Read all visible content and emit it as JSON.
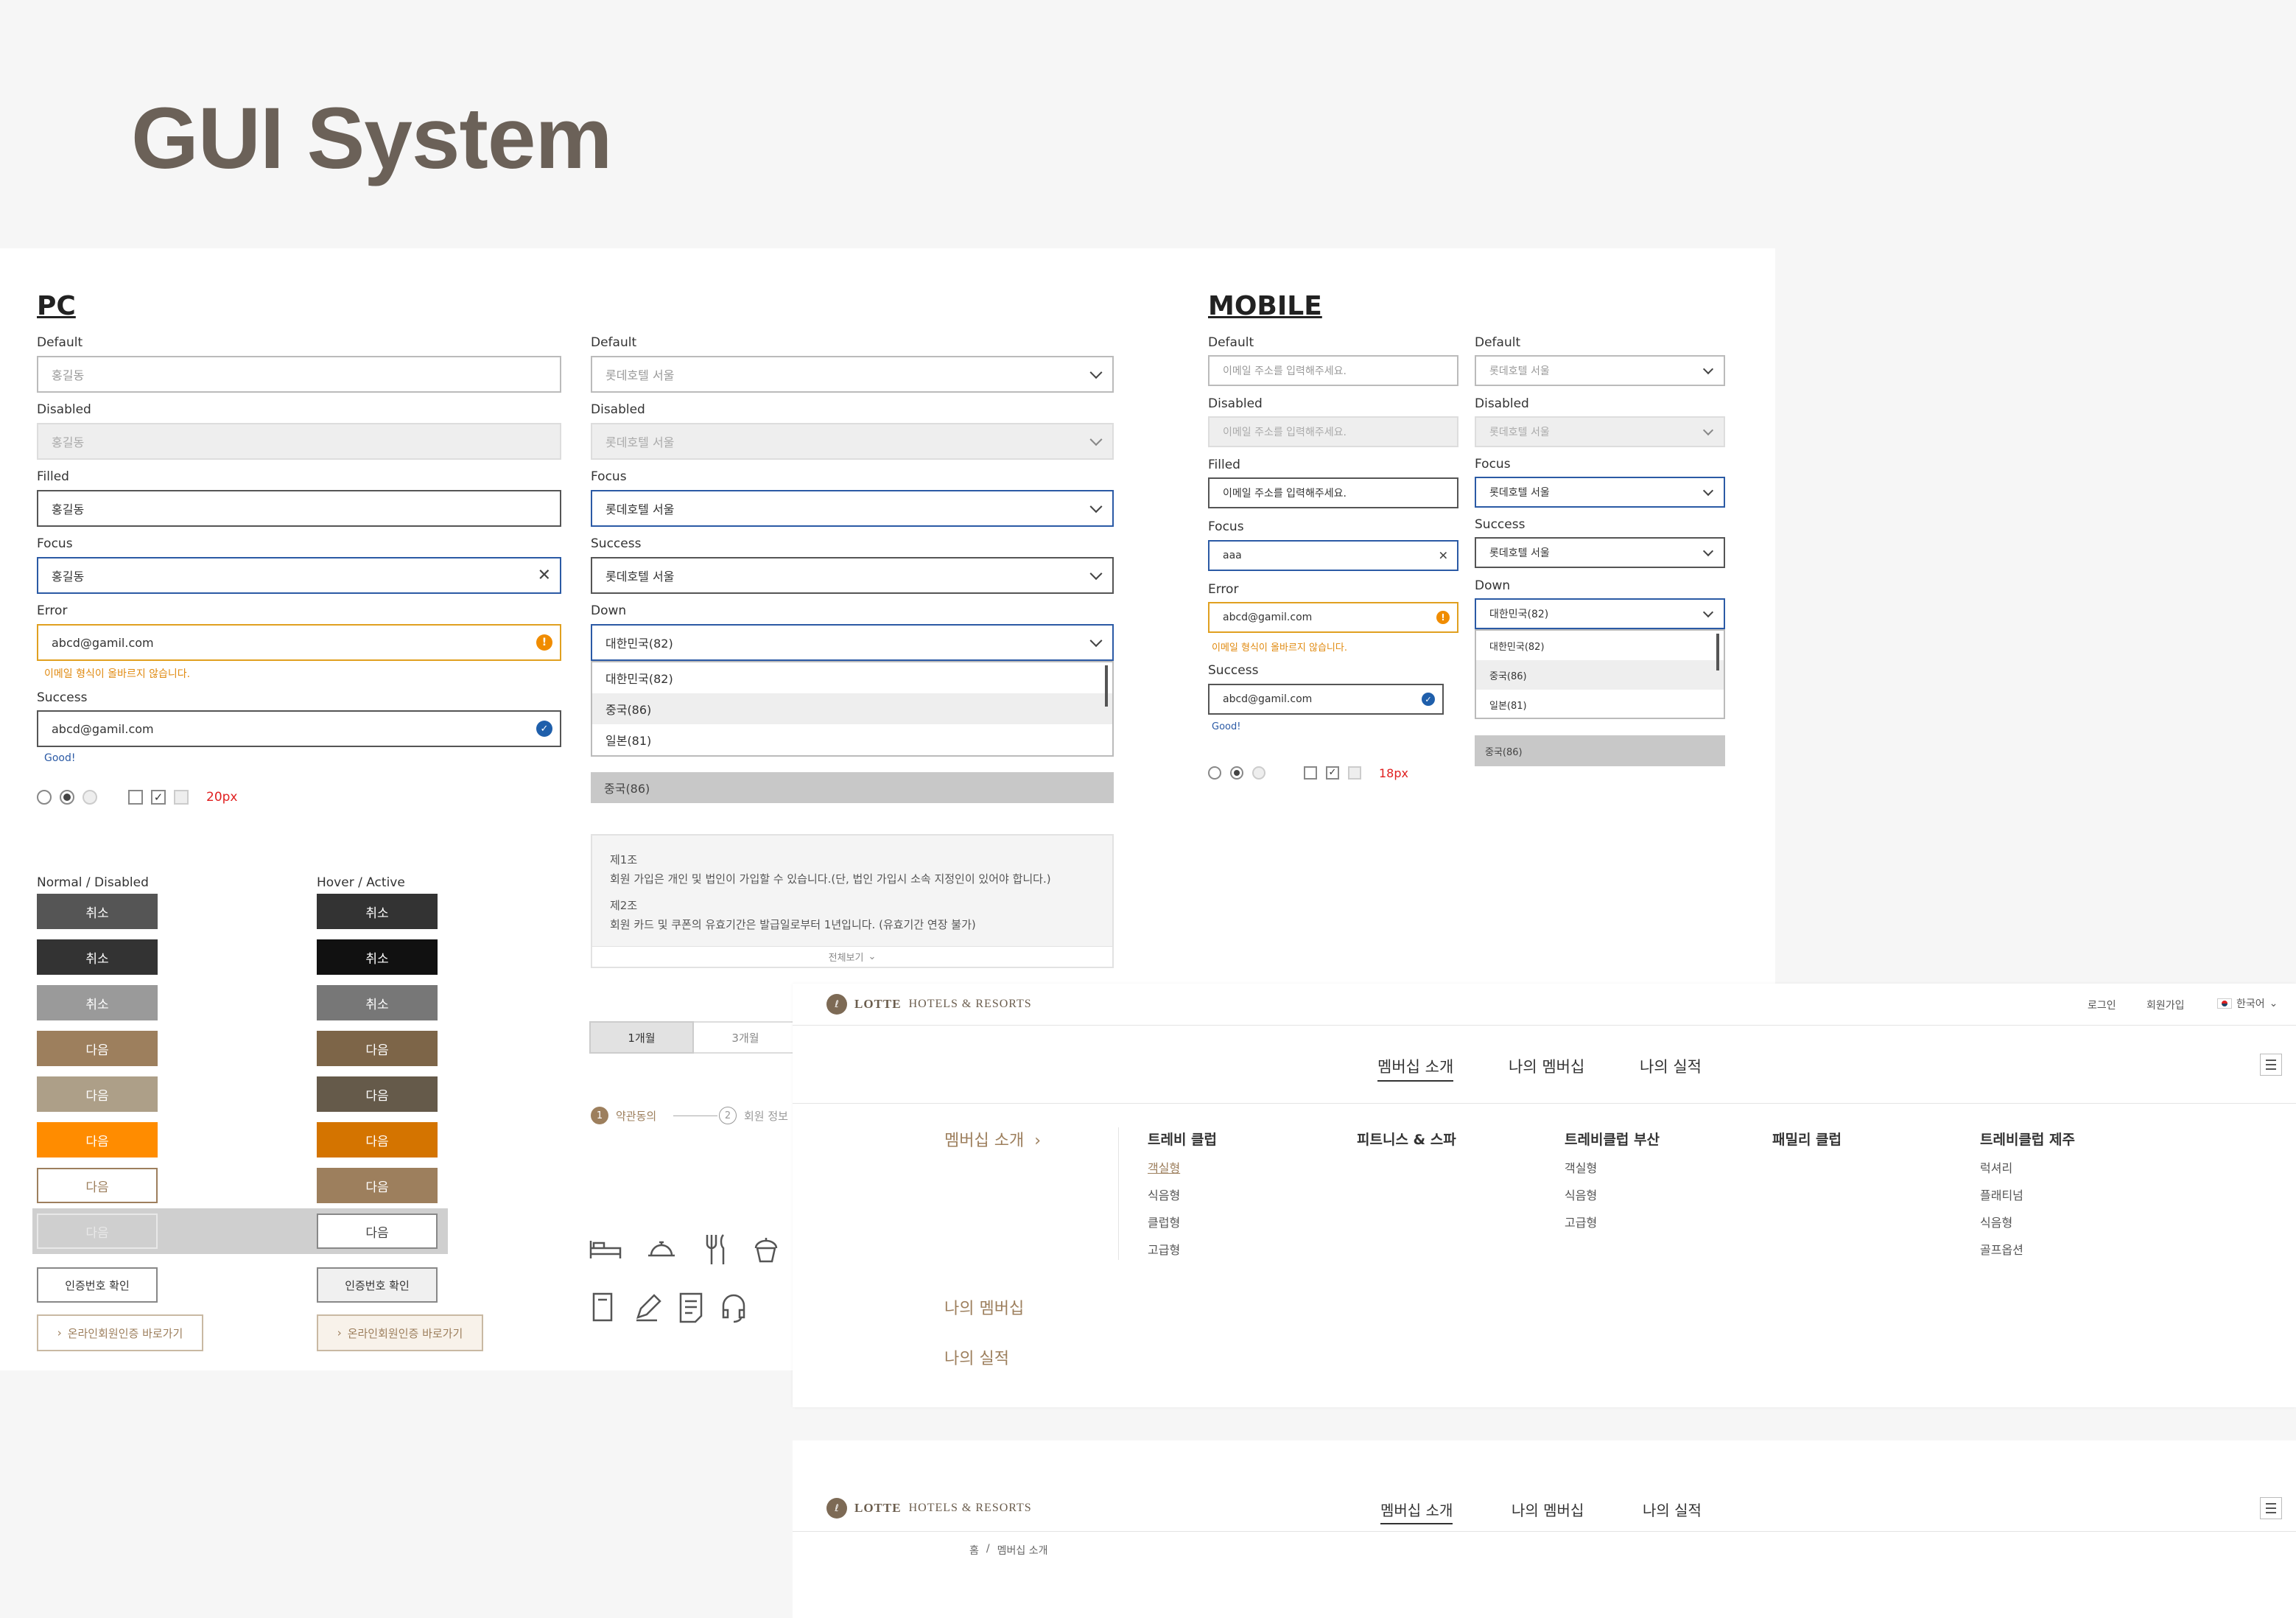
{
  "page_title": "GUI System",
  "pc": {
    "heading": "PC",
    "inputs": [
      {
        "label": "Default",
        "value": "홍길동"
      },
      {
        "label": "Disabled",
        "value": "홍길동"
      },
      {
        "label": "Filled",
        "value": "홍길동"
      },
      {
        "label": "Focus",
        "value": "홍길동"
      },
      {
        "label": "Error",
        "value": "abcd@gamil.com",
        "message": "이메일 형식이 올바르지 않습니다."
      },
      {
        "label": "Success",
        "value": "abcd@gamil.com",
        "message": "Good!"
      }
    ],
    "checkbox_size_note": "20px",
    "selects": [
      {
        "label": "Default",
        "value": "롯데호텔 서울"
      },
      {
        "label": "Disabled",
        "value": "롯데호텔 서울"
      },
      {
        "label": "Focus",
        "value": "롯데호텔 서울"
      },
      {
        "label": "Success",
        "value": "롯데호텔 서울"
      },
      {
        "label": "Down",
        "value": "대한민국(82)"
      }
    ],
    "dropdown_options": [
      "대한민국(82)",
      "중국(86)",
      "일본(81)"
    ],
    "selected_bar": "중국(86)",
    "terms": {
      "art1_title": "제1조",
      "art1_text": "회원 가입은 개인 및 법인이 가입할 수 있습니다.(단, 법인 가입시 소속 지정인이 있어야 합니다.)",
      "art2_title": "제2조",
      "art2_text": "회원 카드 및 쿠폰의 유효기간은 발급일로부터 1년입니다. (유효기간 연장 불가)",
      "more": "전체보기"
    },
    "tabs": [
      "1개월",
      "3개월"
    ],
    "steps": [
      {
        "num": "1",
        "label": "약관동의"
      },
      {
        "num": "2",
        "label": "회원 정보"
      }
    ],
    "buttons": {
      "normal_title": "Normal / Disabled",
      "hover_title": "Hover / Active",
      "cancel": "취소",
      "next": "다음",
      "verify": "인증번호 확인",
      "online_link": "온라인회원인증 바로가기"
    }
  },
  "mobile": {
    "heading": "MOBILE",
    "inputs": [
      {
        "label": "Default",
        "value": "이메일 주소를 입력해주세요."
      },
      {
        "label": "Disabled",
        "value": "이메일 주소를 입력해주세요."
      },
      {
        "label": "Filled",
        "value": "이메일 주소를 입력해주세요."
      },
      {
        "label": "Focus",
        "value": "aaa"
      },
      {
        "label": "Error",
        "value": "abcd@gamil.com",
        "message": "이메일 형식이 올바르지 않습니다."
      },
      {
        "label": "Success",
        "value": "abcd@gamil.com",
        "message": "Good!"
      }
    ],
    "checkbox_size_note": "18px",
    "selects": [
      {
        "label": "Default",
        "value": "롯데호텔 서울"
      },
      {
        "label": "Disabled",
        "value": "롯데호텔 서울"
      },
      {
        "label": "Focus",
        "value": "롯데호텔 서울"
      },
      {
        "label": "Success",
        "value": "롯데호텔 서울"
      },
      {
        "label": "Down",
        "value": "대한민국(82)"
      }
    ],
    "dropdown_options": [
      "대한민국(82)",
      "중국(86)",
      "일본(81)"
    ],
    "selected_bar": "중국(86)"
  },
  "site": {
    "logo_brand": "LOTTE",
    "logo_rest": "HOTELS & RESORTS",
    "util": [
      "로그인",
      "회원가입",
      "한국어"
    ],
    "nav": [
      "멤버십 소개",
      "나의 멤버십",
      "나의 실적"
    ],
    "mega_side": [
      "멤버십 소개",
      "나의 멤버십",
      "나의 실적"
    ],
    "mega_cols": [
      {
        "head": "트레비 클럽",
        "items": [
          "객실형",
          "식음형",
          "클럽형",
          "고급형"
        ]
      },
      {
        "head": "피트니스 & 스파",
        "items": []
      },
      {
        "head": "트레비클럽 부산",
        "items": [
          "객실형",
          "식음형",
          "고급형"
        ]
      },
      {
        "head": "패밀리 클럽",
        "items": []
      },
      {
        "head": "트레비클럽 제주",
        "items": [
          "럭셔리",
          "플래티넘",
          "식음형",
          "골프옵션"
        ]
      }
    ],
    "breadcrumb": [
      "홈",
      "멤버십 소개"
    ]
  },
  "colors": {
    "brand": "#9d7f5d",
    "focus": "#2b5aa5",
    "error": "#e08a10",
    "orange": "#ff8c00"
  }
}
